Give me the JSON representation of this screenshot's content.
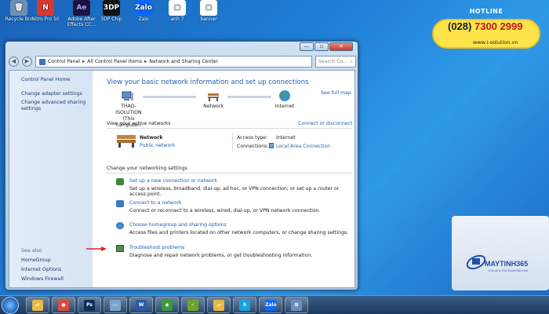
{
  "desktop_icons": [
    {
      "label": "Recycle Bin",
      "glyph": "🗑",
      "bg": "#6f8fb5",
      "fg": "#ffffff"
    },
    {
      "label": "Nitro Pro 10",
      "glyph": "N",
      "bg": "#d9382e",
      "fg": "#ffffff"
    },
    {
      "label": "Adobe After Effects CC...",
      "glyph": "Ae",
      "bg": "#1a1440",
      "fg": "#b7a0ff"
    },
    {
      "label": "3DP Chip",
      "glyph": "3DP",
      "bg": "#111111",
      "fg": "#ffffff"
    },
    {
      "label": "Zalo",
      "glyph": "Zalo",
      "bg": "#0a68ff",
      "fg": "#ffffff"
    },
    {
      "label": "anh 7",
      "glyph": "▢",
      "bg": "#ffffff",
      "fg": "#4a7ab8"
    },
    {
      "label": "banner",
      "glyph": "▢",
      "bg": "#ffffff",
      "fg": "#4a7ab8"
    }
  ],
  "window": {
    "caption_buttons": {
      "minimize": "—",
      "maximize": "▫",
      "close": "✕"
    },
    "nav_back": "◀",
    "nav_forward": "▶",
    "breadcrumb": [
      "Control Panel",
      "All Control Panel Items",
      "Network and Sharing Center"
    ],
    "search_placeholder": "Search Co...",
    "left_pane": {
      "home": "Control Panel Home",
      "links": [
        "Change adapter settings",
        "Change advanced sharing settings"
      ],
      "see_also": "See also",
      "see_also_links": [
        "HomeGroup",
        "Internet Options",
        "Windows Firewall"
      ]
    },
    "main": {
      "title": "View your basic network information and set up connections",
      "see_full_map": "See full map",
      "map": {
        "computer": "THAO-ISOLUTION",
        "computer_sub": "(This computer)",
        "network": "Network",
        "internet": "Internet"
      },
      "active_header": "View your active networks",
      "connect_disconnect": "Connect or disconnect",
      "active_network": {
        "name": "Network",
        "type": "Public network",
        "access_label": "Access type:",
        "access_value": "Internet",
        "connections_label": "Connections:",
        "connections_value": "Local Area Connection"
      },
      "settings_header": "Change your networking settings",
      "tasks": [
        {
          "title": "Set up a new connection or network",
          "desc": "Set up a wireless, broadband, dial-up, ad hoc, or VPN connection; or set up a router or access point."
        },
        {
          "title": "Connect to a network",
          "desc": "Connect or reconnect to a wireless, wired, dial-up, or VPN network connection."
        },
        {
          "title": "Choose homegroup and sharing options",
          "desc": "Access files and printers located on other network computers, or change sharing settings."
        },
        {
          "title": "Troubleshoot problems",
          "desc": "Diagnose and repair network problems, or get troubleshooting information."
        }
      ]
    }
  },
  "hotline": {
    "title": "HOTLINE",
    "phone_prefix": "(028)",
    "phone_number": "7300 2999",
    "url": "www.i-solution.vn"
  },
  "ad": {
    "brand": "MAYTINH365",
    "tagline": "Chia sẻ & Thủ thuật Máy tính"
  },
  "taskbar": {
    "apps": [
      {
        "name": "explorer",
        "glyph": "📁",
        "color": "#e8b84a"
      },
      {
        "name": "chrome",
        "glyph": "●",
        "color": "#e04a3a"
      },
      {
        "name": "photoshop",
        "glyph": "Ps",
        "color": "#0d2f5a"
      },
      {
        "name": "files",
        "glyph": "▭",
        "color": "#7aa4cc"
      },
      {
        "name": "word",
        "glyph": "W",
        "color": "#2b5aa8"
      },
      {
        "name": "corel",
        "glyph": "◉",
        "color": "#3a9a3a"
      },
      {
        "name": "greenshot",
        "glyph": "✓",
        "color": "#6aa52a"
      },
      {
        "name": "folder",
        "glyph": "📂",
        "color": "#e8b84a"
      },
      {
        "name": "skype",
        "glyph": "S",
        "color": "#1aa0e0"
      },
      {
        "name": "zalo",
        "glyph": "Zalo",
        "color": "#0a68ff"
      },
      {
        "name": "network",
        "glyph": "⊞",
        "color": "#6a8fbf"
      }
    ]
  }
}
